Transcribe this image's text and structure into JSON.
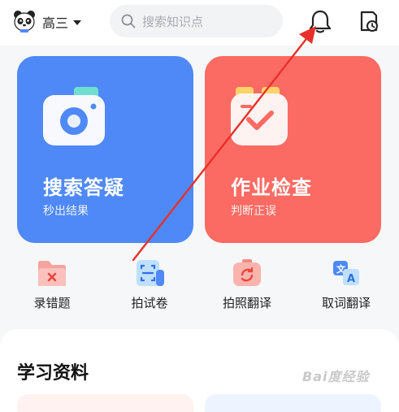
{
  "header": {
    "grade": "高三",
    "search_placeholder": "搜索知识点"
  },
  "cards": [
    {
      "title": "搜索答疑",
      "subtitle": "秒出结果",
      "color": "#4f89f7"
    },
    {
      "title": "作业检查",
      "subtitle": "判断正误",
      "color": "#fb6b63"
    }
  ],
  "tools": [
    {
      "label": "录错题"
    },
    {
      "label": "拍试卷"
    },
    {
      "label": "拍照翻译"
    },
    {
      "label": "取词翻译"
    }
  ],
  "section": {
    "title": "学习资料"
  },
  "colors": {
    "annotation_arrow": "#e8302a"
  }
}
